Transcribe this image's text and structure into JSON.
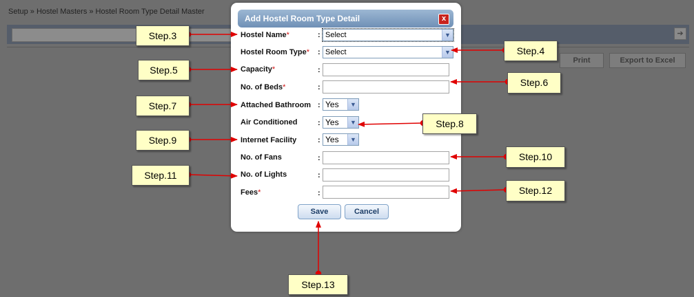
{
  "breadcrumb": "Setup » Hostel Masters » Hostel Room Type Detail Master",
  "background_buttons": {
    "print": "Print",
    "export": "Export to Excel"
  },
  "modal": {
    "title": "Add Hostel Room Type Detail",
    "close": "x",
    "fields": {
      "hostel_name": {
        "label": "Hostel Name",
        "required": "*",
        "value": "Select"
      },
      "room_type": {
        "label": "Hostel Room Type",
        "required": "*",
        "value": "Select"
      },
      "capacity": {
        "label": "Capacity",
        "required": "*"
      },
      "beds": {
        "label": "No. of Beds",
        "required": "*"
      },
      "bathroom": {
        "label": "Attached Bathroom",
        "value": "Yes"
      },
      "ac": {
        "label": "Air Conditioned",
        "value": "Yes"
      },
      "internet": {
        "label": "Internet Facility",
        "value": "Yes"
      },
      "fans": {
        "label": "No. of Fans"
      },
      "lights": {
        "label": "No. of Lights"
      },
      "fees": {
        "label": "Fees",
        "required": "*"
      }
    },
    "colon": ":",
    "save": "Save",
    "cancel": "Cancel"
  },
  "steps": {
    "s3": "Step.3",
    "s4": "Step.4",
    "s5": "Step.5",
    "s6": "Step.6",
    "s7": "Step.7",
    "s8": "Step.8",
    "s9": "Step.9",
    "s10": "Step.10",
    "s11": "Step.11",
    "s12": "Step.12",
    "s13": "Step.13"
  },
  "annotation_color": "#e00000"
}
